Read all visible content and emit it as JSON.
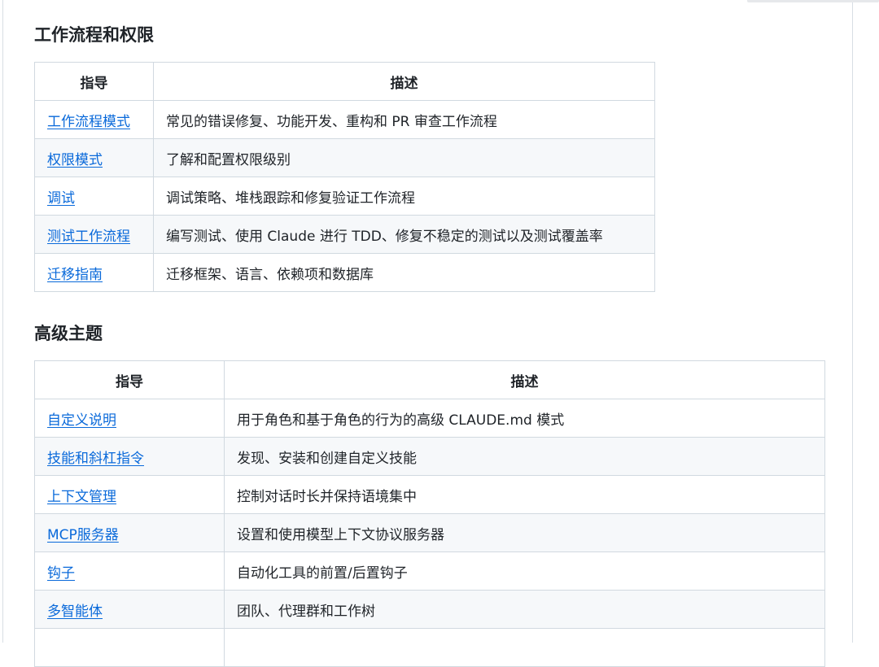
{
  "sections": [
    {
      "heading": "工作流程和权限",
      "columns": [
        "指导",
        "描述"
      ],
      "rows": [
        {
          "guide": "工作流程模式",
          "description": "常见的错误修复、功能开发、重构和 PR 审查工作流程"
        },
        {
          "guide": "权限模式",
          "description": "了解和配置权限级别"
        },
        {
          "guide": "调试",
          "description": "调试策略、堆栈跟踪和修复验证工作流程"
        },
        {
          "guide": "测试工作流程",
          "description": "编写测试、使用 Claude 进行 TDD、修复不稳定的测试以及测试覆盖率"
        },
        {
          "guide": "迁移指南",
          "description": "迁移框架、语言、依赖项和数据库"
        }
      ]
    },
    {
      "heading": "高级主题",
      "columns": [
        "指导",
        "描述"
      ],
      "rows": [
        {
          "guide": "自定义说明",
          "description": "用于角色和基于角色的行为的高级 CLAUDE.md 模式"
        },
        {
          "guide": "技能和斜杠指令",
          "description": "发现、安装和创建自定义技能"
        },
        {
          "guide": "上下文管理",
          "description": "控制对话时长并保持语境集中"
        },
        {
          "guide": "MCP服务器",
          "description": "设置和使用模型上下文协议服务器"
        },
        {
          "guide": "钩子",
          "description": "自动化工具的前置/后置钩子"
        },
        {
          "guide": "多智能体",
          "description": "团队、代理群和工作树"
        },
        {
          "guide": "",
          "description": ""
        }
      ]
    }
  ]
}
